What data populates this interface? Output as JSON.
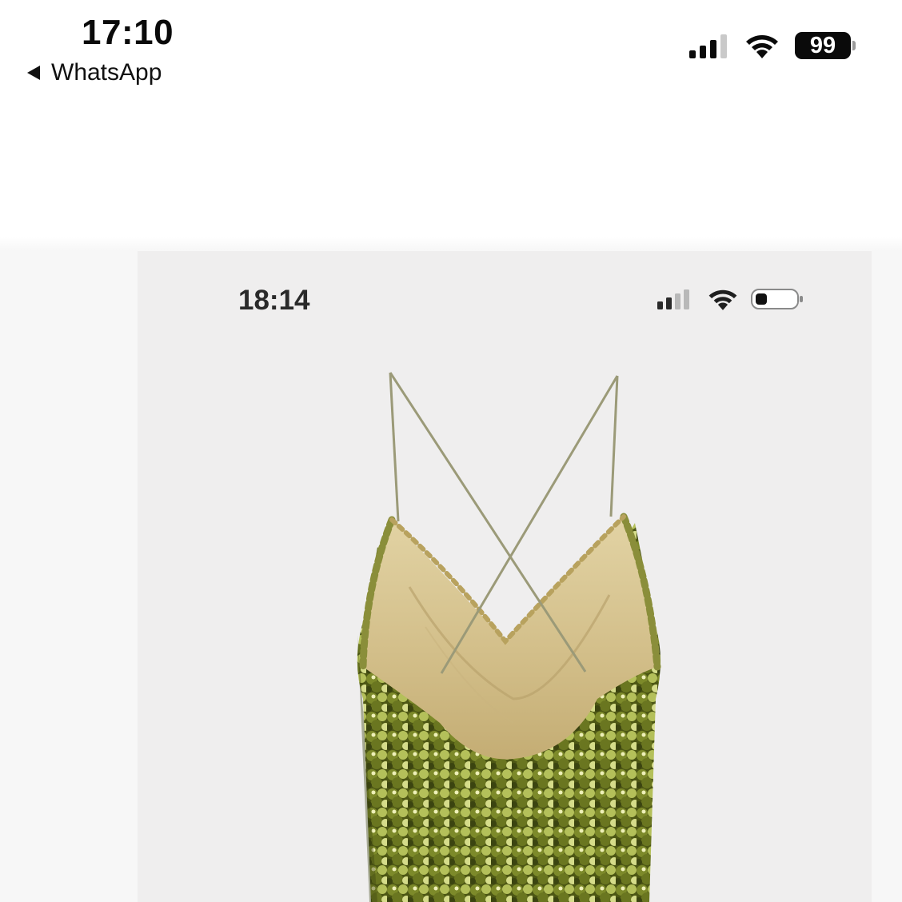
{
  "status_bar": {
    "time": "17:10",
    "back_label": "WhatsApp",
    "back_icon": "back-triangle-icon",
    "signal_icon": "cellular-signal-icon",
    "wifi_icon": "wifi-icon",
    "battery_level": "99",
    "battery_icon": "battery-icon"
  },
  "shared_image": {
    "inner_status_bar": {
      "time": "18:14",
      "signal_icon": "cellular-signal-icon",
      "wifi_icon": "wifi-icon",
      "battery_icon": "battery-low-icon"
    },
    "photo_subject": "green sequin slip dress with gold satin cowl neckline and crossed back straps",
    "colors": {
      "sequin_green": "#5f6a1e",
      "satin_gold": "#d8c592",
      "background": "#efeeee"
    }
  }
}
